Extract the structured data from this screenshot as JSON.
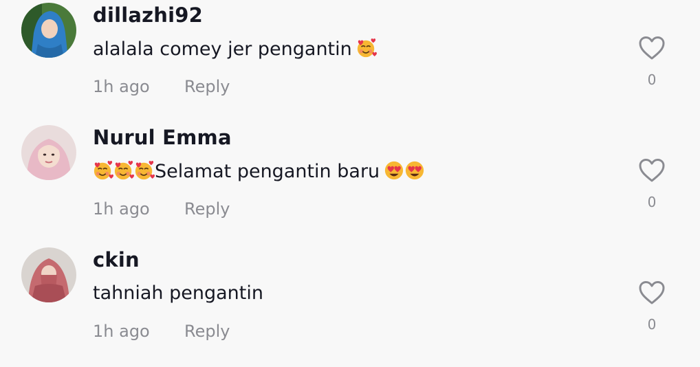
{
  "comments": [
    {
      "username": "dillazhi92",
      "text": "alalala comey jer pengantin",
      "emojis_after": [
        "smiling-face-with-hearts"
      ],
      "time": "1h ago",
      "reply_label": "Reply",
      "like_count": "0"
    },
    {
      "username": "Nurul Emma",
      "emojis_before": [
        "smiling-face-with-hearts",
        "smiling-face-with-hearts",
        "smiling-face-with-hearts"
      ],
      "text": "Selamat pengantin baru",
      "emojis_after": [
        "heart-eyes",
        "heart-eyes"
      ],
      "time": "1h ago",
      "reply_label": "Reply",
      "like_count": "0"
    },
    {
      "username": "ckin",
      "text": "tahniah pengantin",
      "time": "1h ago",
      "reply_label": "Reply",
      "like_count": "0"
    }
  ],
  "colors": {
    "background": "#f8f8f8",
    "primary_text": "#161823",
    "secondary_text": "#8a8b91",
    "icon_outline": "#8a8b91"
  }
}
